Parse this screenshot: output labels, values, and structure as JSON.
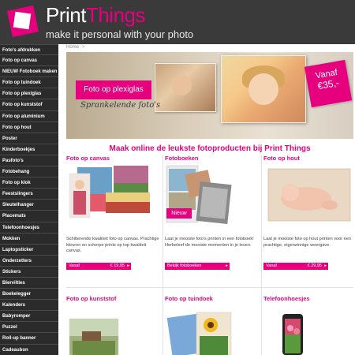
{
  "brand": {
    "name_part1": "Print",
    "name_part2": "Things",
    "tagline": "make it personal with your photo",
    "accent": "#e6007e"
  },
  "breadcrumb": {
    "home": "Home",
    "separator": ">"
  },
  "sidebar": {
    "items": [
      {
        "label": "Foto's afdrukken"
      },
      {
        "label": "Foto op canvas"
      },
      {
        "label": "NIEUW Fotoboek maken"
      },
      {
        "label": "Foto op tuindoek"
      },
      {
        "label": "Foto op plexiglas"
      },
      {
        "label": "Foto op kunststof"
      },
      {
        "label": "Foto op aluminium"
      },
      {
        "label": "Foto op hout"
      },
      {
        "label": "Poster"
      },
      {
        "label": "Kinderboekjes"
      },
      {
        "label": "Pasfoto's"
      },
      {
        "label": "Fotobehang"
      },
      {
        "label": "Foto op klok"
      },
      {
        "label": "Feestslingers"
      },
      {
        "label": "Sleutelhanger"
      },
      {
        "label": "Placemats"
      },
      {
        "label": "Telefoonhoesjes"
      },
      {
        "label": "Mokken"
      },
      {
        "label": "Laptopsticker"
      },
      {
        "label": "Onderzetters"
      },
      {
        "label": "Stickers"
      },
      {
        "label": "Biervilties"
      },
      {
        "label": "Boekelegger"
      },
      {
        "label": "Kalenders"
      },
      {
        "label": "Babyromper"
      },
      {
        "label": "Puzzel"
      },
      {
        "label": "Roll-up banner"
      },
      {
        "label": "Cadeaubon"
      }
    ]
  },
  "banner": {
    "tag": "Foto op plexiglas",
    "subtitle": "Sprankelende foto's",
    "vanaf_label": "Vanaf",
    "vanaf_price": "€35,-"
  },
  "headline": "Maak online de leukste fotoproducten bij Print Things",
  "products": [
    {
      "title": "Foto op canvas",
      "desc": "Schitterende kwaliteit foto op canvas. Prachtige kleuren en scherpe prints op top kwaliteit canvas.",
      "button_label": "Vanaf",
      "button_price": "€ 19,95",
      "arrow": "▸"
    },
    {
      "title": "Fotoboeken",
      "badge": "Nieuw",
      "desc": "Laat je mooiste foto's printen in een fotoboek! Herbeleef de mooiste momenten in je leven.",
      "button_label": "Bekijk fotoboeken",
      "arrow": "▸"
    },
    {
      "title": "Foto op hout",
      "desc": "Laat je mooiste foto op hout printen voor een prachtige, eigenzinnige weergave.",
      "button_label": "Vanaf",
      "button_price": "€ 29,95",
      "arrow": "▸"
    },
    {
      "title": "Foto op kunststof"
    },
    {
      "title": "Foto op tuindoek"
    },
    {
      "title": "Telefoonhoesjes"
    }
  ]
}
